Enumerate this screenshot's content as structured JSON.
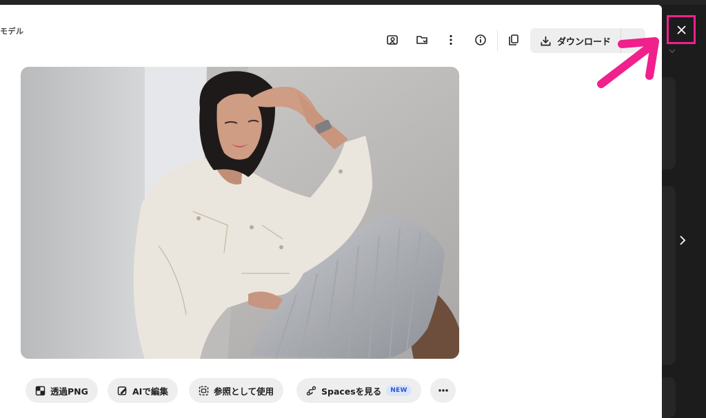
{
  "header": {
    "model_label": "モデル",
    "toolbar_icons": [
      "image-search-icon",
      "folder-add-icon",
      "more-vertical-icon",
      "info-icon",
      "copy-icon"
    ],
    "download_label": "ダウンロード"
  },
  "photo": {
    "subject": "woman-in-white-denim-jacket-photo"
  },
  "actions": [
    {
      "label": "透過PNG",
      "icon": "transparent-png-icon"
    },
    {
      "label": "AIで編集",
      "icon": "ai-edit-icon"
    },
    {
      "label": "参照として使用",
      "icon": "reference-icon"
    },
    {
      "label": "Spacesを見る",
      "icon": "spaces-icon",
      "badge": "NEW"
    }
  ],
  "colors": {
    "highlight": "#f0208c",
    "panel_bg": "#ffffff",
    "backdrop": "#1c1c1c",
    "chip_bg": "#eeeeef",
    "badge_bg": "#d9e4ff",
    "badge_text": "#2b56c8"
  }
}
